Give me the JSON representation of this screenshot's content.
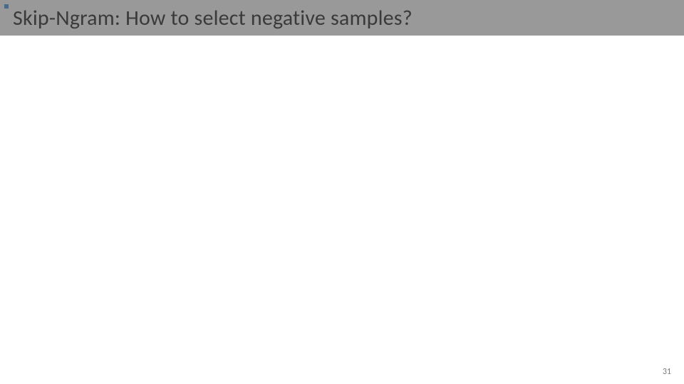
{
  "slide": {
    "title": "Skip-Ngram: How to select negative samples?",
    "page_number": "31"
  }
}
